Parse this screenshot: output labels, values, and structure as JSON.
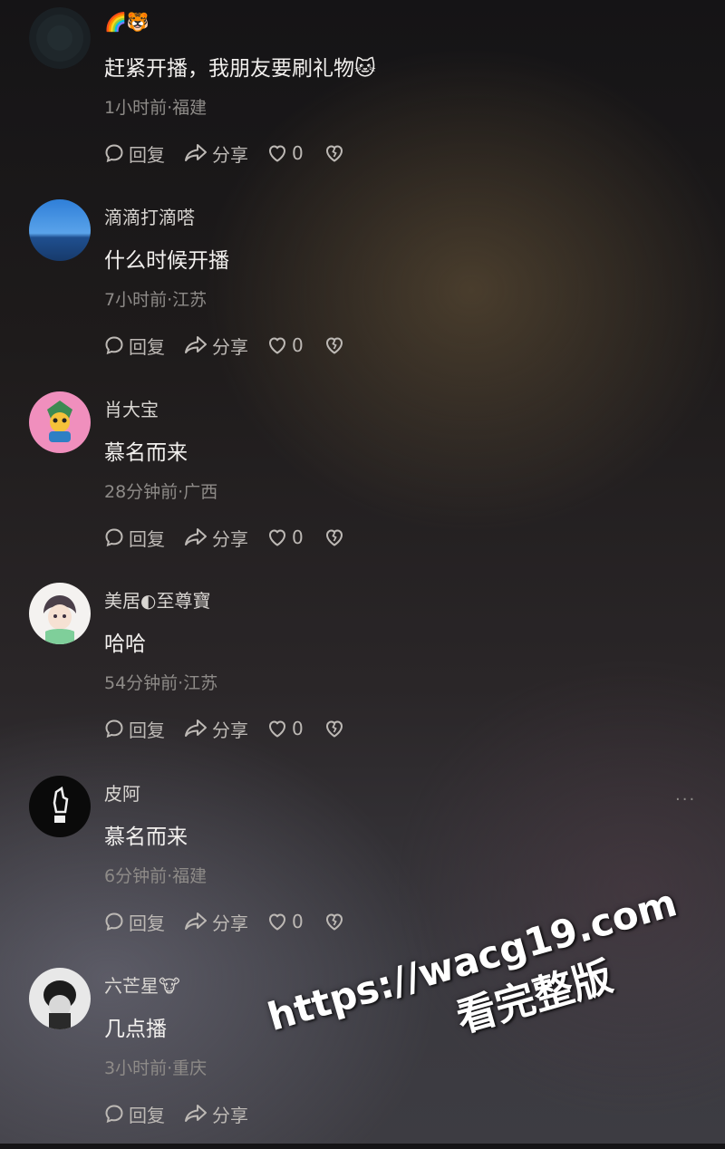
{
  "actions": {
    "reply_label": "回复",
    "share_label": "分享"
  },
  "comments": [
    {
      "username": "🌈🐯",
      "text": "赶紧开播，我朋友要刷礼物🐱",
      "meta": "1小时前·福建",
      "likes": "0",
      "avatar_icon": "dark-avatar-icon"
    },
    {
      "username": "滴滴打滴嗒",
      "text": "什么时候开播",
      "meta": "7小时前·江苏",
      "likes": "0",
      "avatar_icon": "sky-sea-avatar-icon"
    },
    {
      "username": "肖大宝",
      "text": "慕名而来",
      "meta": "28分钟前·广西",
      "likes": "0",
      "avatar_icon": "cartoon-character-avatar-icon"
    },
    {
      "username": "美居◐至尊寶",
      "text": "哈哈",
      "meta": "54分钟前·江苏",
      "likes": "0",
      "avatar_icon": "anime-boy-avatar-icon"
    },
    {
      "username": "皮阿",
      "text": "慕名而来",
      "meta": "6分钟前·福建",
      "likes": "0",
      "avatar_icon": "hand-sketch-avatar-icon"
    },
    {
      "username": "六芒星🐮",
      "text": "几点播",
      "meta": "3小时前·重庆",
      "likes": "",
      "avatar_icon": "bw-photo-avatar-icon"
    }
  ],
  "more_menu": "···",
  "watermark": {
    "url": "https://wacg19.com",
    "subtitle": "看完整版"
  }
}
